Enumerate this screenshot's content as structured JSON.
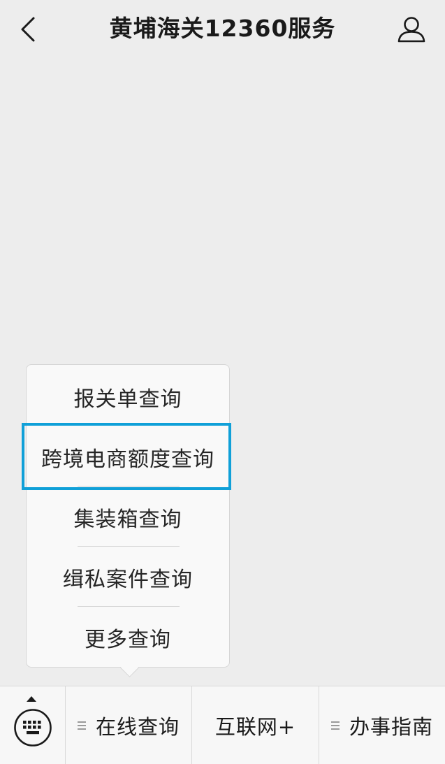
{
  "nav": {
    "title": "黄埔海关12360服务",
    "back_icon": "chevron-left-icon",
    "profile_icon": "user-icon"
  },
  "popup": {
    "items": [
      {
        "label": "报关单查询"
      },
      {
        "label": "跨境电商额度查询",
        "highlighted": true
      },
      {
        "label": "集装箱查询"
      },
      {
        "label": "缉私案件查询"
      },
      {
        "label": "更多查询"
      }
    ]
  },
  "bottom_menu": {
    "keyboard_icon": "keyboard-icon",
    "tabs": [
      {
        "label": "在线查询",
        "has_submenu": true,
        "active": true
      },
      {
        "label": "互联网+",
        "has_submenu": false
      },
      {
        "label": "办事指南",
        "has_submenu": true
      }
    ]
  },
  "colors": {
    "background": "#ededed",
    "highlight_border": "#10a0d8",
    "text": "#1a1a1a"
  }
}
